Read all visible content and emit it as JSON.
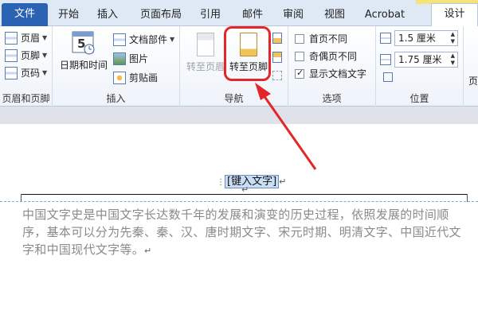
{
  "tabs": {
    "file": "文件",
    "home": "开始",
    "insert": "插入",
    "page_layout": "页面布局",
    "references": "引用",
    "mailings": "邮件",
    "review": "审阅",
    "view": "视图",
    "acrobat": "Acrobat",
    "design": "设计"
  },
  "ribbon": {
    "header_footer": {
      "label": "页眉和页脚",
      "header": "页眉",
      "footer": "页脚",
      "page_number": "页码"
    },
    "insert": {
      "label": "插入",
      "date_time": "日期和时间",
      "date_icon_number": "5",
      "doc_parts": "文档部件",
      "picture": "图片",
      "clip_art": "剪贴画"
    },
    "navigation": {
      "label": "导航",
      "goto_header": "转至页眉",
      "goto_footer": "转至页脚"
    },
    "options": {
      "label": "选项",
      "different_first": "首页不同",
      "different_odd_even": "奇偶页不同",
      "show_doc_text": "显示文档文字",
      "different_first_checked": false,
      "different_odd_even_checked": false,
      "show_doc_text_checked": true
    },
    "position": {
      "label": "位置",
      "header_from_top": "1.5 厘米",
      "footer_from_bottom": "1.75 厘米"
    },
    "close_partial": "页"
  },
  "document": {
    "header_placeholder": "[键入文字]",
    "paragraph": "中国文字史是中国文字长达数千年的发展和演变的历史过程，依照发展的时间顺序，基本可以分为先秦、秦、汉、唐时期文字、宋元时期、明清文字、中国近代文字和中国现代文字等。",
    "para_mark": "↵"
  },
  "colors": {
    "file_tab": "#2a62b4",
    "highlight": "#e3262a",
    "tools_strip": "#f4e27a"
  }
}
